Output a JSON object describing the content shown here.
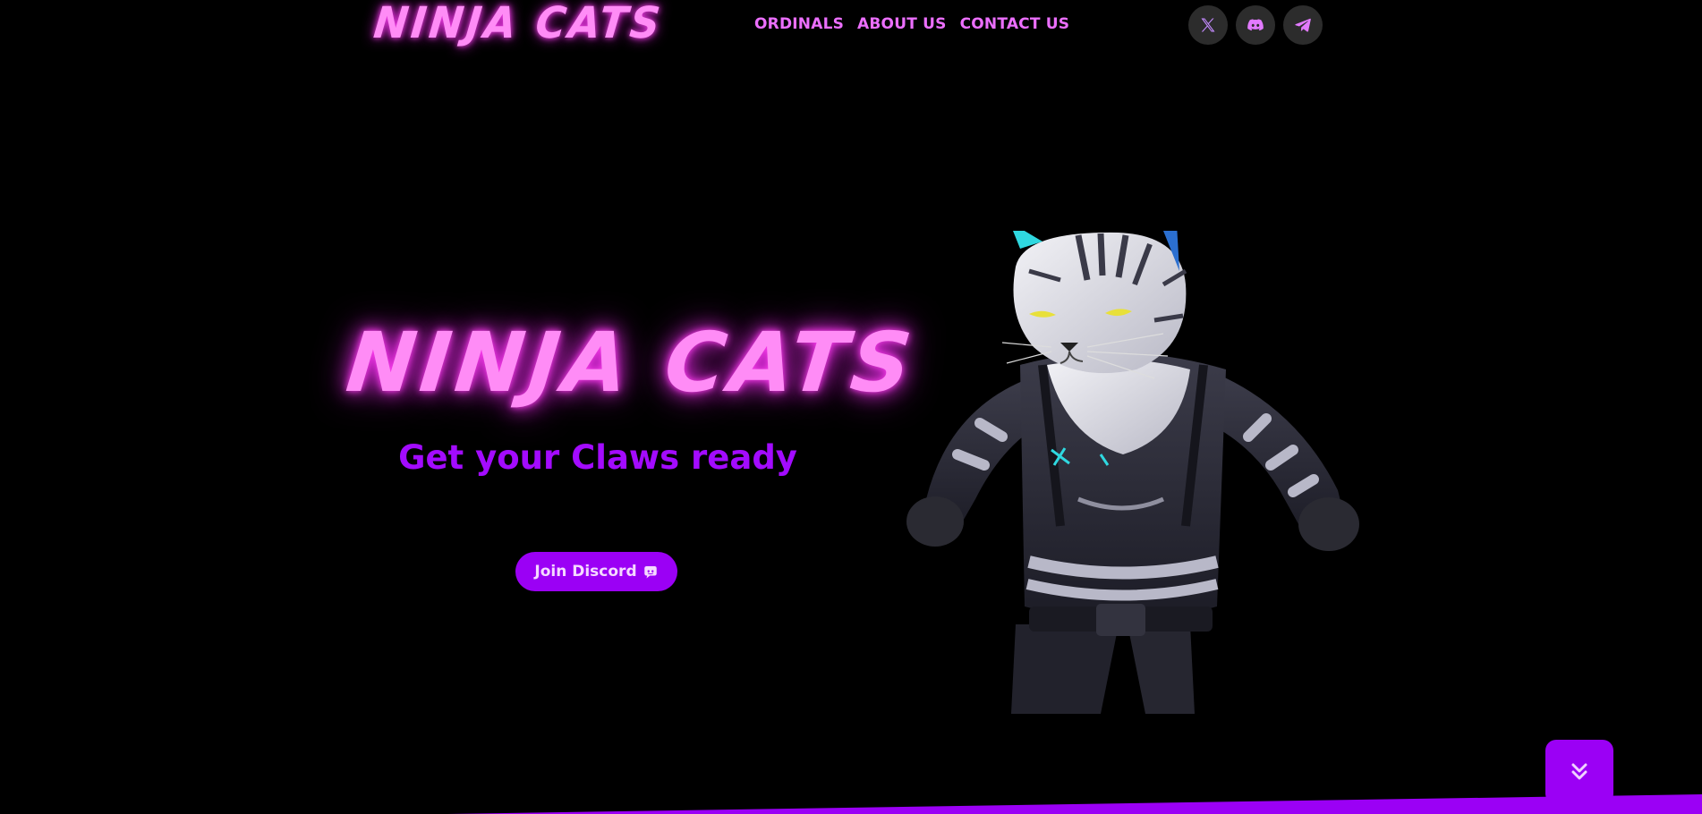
{
  "brand": {
    "logo_text": "NINJA CATS",
    "accent_color": "#ff8cf6",
    "button_color": "#9b00f5",
    "tagline_color": "#a30bff"
  },
  "nav": {
    "items": [
      {
        "label": "ORDINALS"
      },
      {
        "label": "ABOUT US"
      },
      {
        "label": "CONTACT US"
      }
    ]
  },
  "socials": [
    {
      "icon": "x-twitter-icon"
    },
    {
      "icon": "discord-icon"
    },
    {
      "icon": "telegram-icon"
    }
  ],
  "hero": {
    "title": "NINJA CATS",
    "tagline": "Get your Claws ready",
    "cta_label": "Join Discord",
    "cta_icon": "discord-icon"
  },
  "mascot": {
    "icon": "ninja-cat-mascot-image"
  },
  "scroll_button": {
    "icon": "double-chevron-down-icon"
  }
}
